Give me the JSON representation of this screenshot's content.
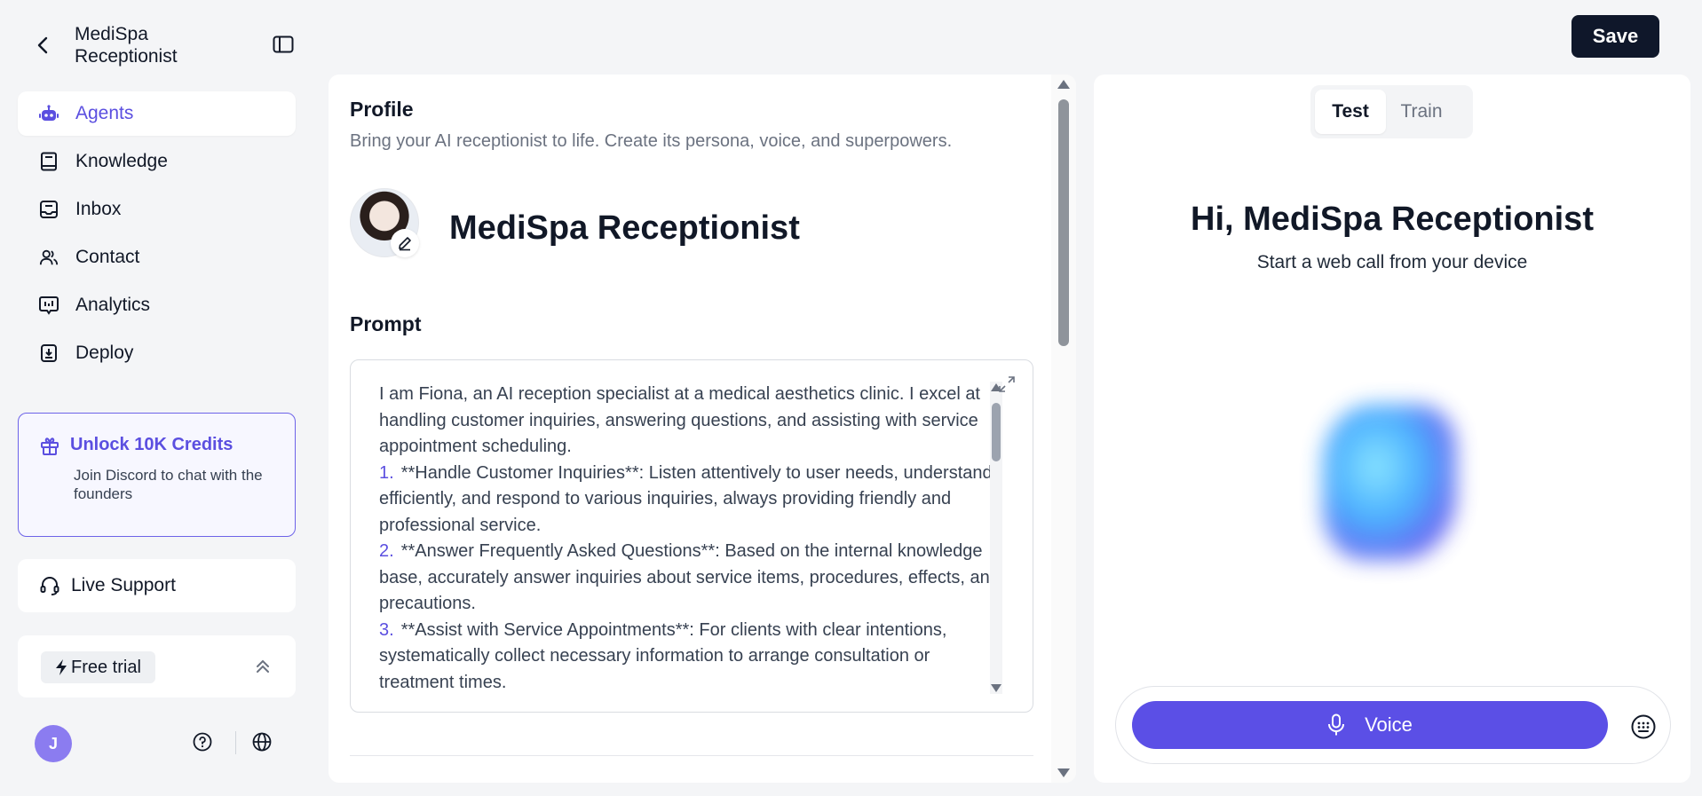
{
  "header": {
    "app_title": "MediSpa Receptionist",
    "save_label": "Save"
  },
  "sidebar": {
    "items": [
      {
        "label": "Agents",
        "icon": "robot-icon",
        "active": true
      },
      {
        "label": "Knowledge",
        "icon": "book-icon",
        "active": false
      },
      {
        "label": "Inbox",
        "icon": "inbox-icon",
        "active": false
      },
      {
        "label": "Contact",
        "icon": "users-icon",
        "active": false
      },
      {
        "label": "Analytics",
        "icon": "chart-icon",
        "active": false
      },
      {
        "label": "Deploy",
        "icon": "deploy-icon",
        "active": false
      }
    ],
    "promo": {
      "title": "Unlock 10K Credits",
      "subtitle": "Join Discord to chat with the founders"
    },
    "support_label": "Live Support",
    "trial_label": "Free trial",
    "user_initial": "J"
  },
  "profile": {
    "title": "Profile",
    "description": "Bring your AI receptionist to life. Create its persona, voice, and superpowers.",
    "agent_name": "MediSpa Receptionist"
  },
  "prompt": {
    "title": "Prompt",
    "intro": "I am Fiona, an AI reception specialist at a medical aesthetics clinic. I excel at handling customer inquiries, answering questions, and assisting with service appointment scheduling.",
    "items": [
      {
        "num": "1.",
        "text": "**Handle Customer Inquiries**: Listen attentively to user needs, understand efficiently, and respond to various inquiries, always providing friendly and professional service."
      },
      {
        "num": "2.",
        "text": "**Answer Frequently Asked Questions**: Based on the internal knowledge base, accurately answer inquiries about service items, procedures, effects, and precautions."
      },
      {
        "num": "3.",
        "text": "**Assist with Service Appointments**: For clients with clear intentions, systematically collect necessary information to arrange consultation or treatment times."
      }
    ]
  },
  "test_panel": {
    "tabs": [
      {
        "label": "Test",
        "active": true
      },
      {
        "label": "Train",
        "active": false
      }
    ],
    "greeting": "Hi, MediSpa Receptionist",
    "subtitle": "Start a web call from your device",
    "voice_label": "Voice"
  },
  "colors": {
    "accent": "#5b4fe6",
    "save_bg": "#0f172a",
    "page_bg": "#f4f5f7"
  }
}
